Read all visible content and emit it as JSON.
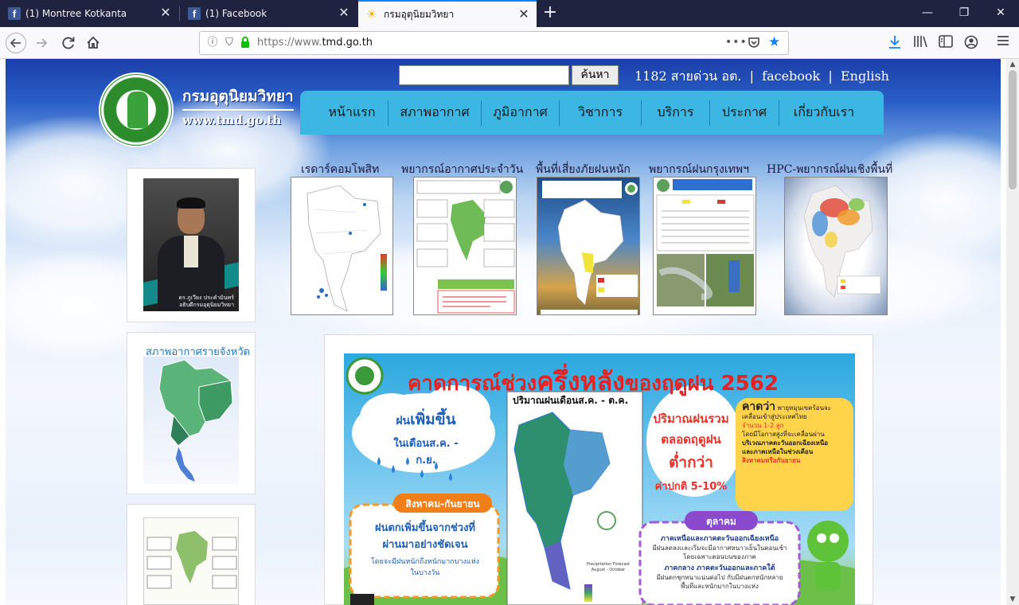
{
  "browser": {
    "tabs": [
      {
        "title": "(1) Montree Kotkanta",
        "icon": "facebook-icon"
      },
      {
        "title": "(1) Facebook",
        "icon": "facebook-icon"
      },
      {
        "title": "กรมอุตุนิยมวิทยา",
        "icon": "sun-icon",
        "active": true
      }
    ],
    "url_prefix": "https://www.",
    "url_domain": "tmd.go.th",
    "url_suffix": ""
  },
  "site": {
    "logo_th": "กรมอุตุนิยมวิทยา",
    "logo_en": "www.tmd.go.th",
    "search_button": "ค้นหา",
    "search_value": "",
    "hotline": "1182 สายด่วน อต.",
    "sep": "|",
    "facebook": "facebook",
    "english": "English",
    "menu": [
      "หน้าแรก",
      "สภาพอากาศ",
      "ภูมิอากาศ",
      "วิชาการ",
      "บริการ",
      "ประกาศ",
      "เกี่ยวกับเรา"
    ],
    "director_caption_1": "ดร.ภูเวียง ประคำมินทร์",
    "director_caption_2": "อธิบดีกรมอุตุนิยมวิทยา",
    "province_title": "สภาพอากาศรายจังหวัด",
    "features": [
      "เรดาร์คอมโพสิท",
      "พยากรณ์อากาศประจำวัน",
      "พื้นที่เสี่ยงภัยฝนหนัก",
      "พยากรณ์ฝนกรุงเทพฯ",
      "HPC-พยากรณ์ฝนเชิงพื้นที่"
    ]
  },
  "poster": {
    "title_a": "คาดการณ์ช่วง",
    "title_b": "ครึ่งหลัง",
    "title_c": "ของฤดูฝน 2562",
    "cloud1_a": "ฝน",
    "cloud1_b": "เพิ่มขึ้น",
    "cloud1_c": "ในเดือนส.ค. - ก.ย.",
    "map_header": "ปริมาณฝนเดือนส.ค. - ต.ค.",
    "rain_total_1": "ปริมาณฝนรวม",
    "rain_total_2": "ตลอดฤดูฝน",
    "rain_total_3": "ต่ำกว่า",
    "rain_total_4": "ค่าปกติ 5-10%",
    "storm_head": "คาดว่า",
    "storm_1": "พายุหมุนเขตร้อนจะ",
    "storm_2": "เคลื่อนเข้าสู่ประเทศไทย",
    "storm_3": "จำนวน 1-2 ลูก",
    "storm_4": "โดยมีโอกาสสูงที่จะเคลื่อนผ่าน",
    "storm_5": "บริเวณภาคตะวันออกเฉียงเหนือ",
    "storm_6": "และภาคเหนือในช่วงเดือน",
    "storm_7": "สิงหาคมหรือกันยายน",
    "aug_sep": "สิงหาคม-กันยายน",
    "aug_1": "ฝนตกเพิ่มขึ้นจากช่วงที่",
    "aug_2": "ผ่านมาอย่างชัดเจน",
    "aug_3": "โดยจะมีฝนหนักถึงหนักมากบางแห่ง",
    "aug_4": "ในบางวัน",
    "oct": "ตุลาคม",
    "oct_1": "ภาคเหนือและภาคตะวันออกเฉียงเหนือ",
    "oct_2": "มีฝนลดลงและเริ่มจะมีอากาศหนาวเย็นในตอนเช้า",
    "oct_3": "โดยเฉพาะตอนบนของภาค",
    "oct_4": "ภาคกลาง ภาคตะวันออกและภาคใต้",
    "oct_5": "มีฝนตกชุกหนาแน่นต่อไป กับมีฝนตกหนักหลาย",
    "oct_6": "พื้นที่และหนักมากในบางแห่ง",
    "legend_title": "Precipitation Forecast",
    "legend_sub": "August - October"
  },
  "colors": {
    "menu_bar": "#3cb6e3",
    "poster_title": "#e52222",
    "tab_accent": "#0a84ff",
    "lock": "#12bc00"
  }
}
